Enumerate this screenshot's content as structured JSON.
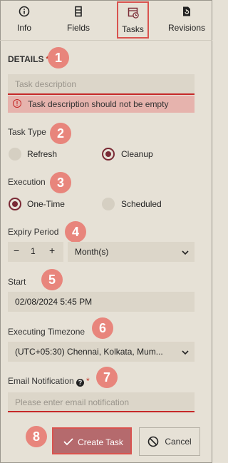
{
  "tabs": [
    {
      "label": "Info",
      "icon": "info-icon"
    },
    {
      "label": "Fields",
      "icon": "fields-icon"
    },
    {
      "label": "Tasks",
      "icon": "tasks-icon",
      "active": true
    },
    {
      "label": "Revisions",
      "icon": "revisions-icon"
    }
  ],
  "badges": [
    "1",
    "2",
    "3",
    "4",
    "5",
    "6",
    "7",
    "8"
  ],
  "details": {
    "label": "DETAILS",
    "required_mark": "*",
    "placeholder": "Task description",
    "error": "Task description should not be empty"
  },
  "task_type": {
    "label": "Task Type",
    "options": [
      "Refresh",
      "Cleanup"
    ],
    "selected": "Cleanup"
  },
  "execution": {
    "label": "Execution",
    "options": [
      "One-Time",
      "Scheduled"
    ],
    "selected": "One-Time"
  },
  "expiry": {
    "label": "Expiry Period",
    "minus": "−",
    "value": "1",
    "plus": "+",
    "unit": "Month(s)"
  },
  "start": {
    "label": "Start",
    "value": "02/08/2024 5:45 PM"
  },
  "timezone": {
    "label": "Executing Timezone",
    "value": "(UTC+05:30) Chennai, Kolkata, Mum..."
  },
  "email": {
    "label": "Email Notification",
    "help": "?",
    "required_mark": "*",
    "placeholder": "Please enter email notification"
  },
  "buttons": {
    "create": "Create Task",
    "cancel": "Cancel"
  },
  "colors": {
    "accent": "#7a2a35",
    "badge": "#e8857c",
    "error": "#c62828",
    "primary_button": "#b56a6d"
  }
}
